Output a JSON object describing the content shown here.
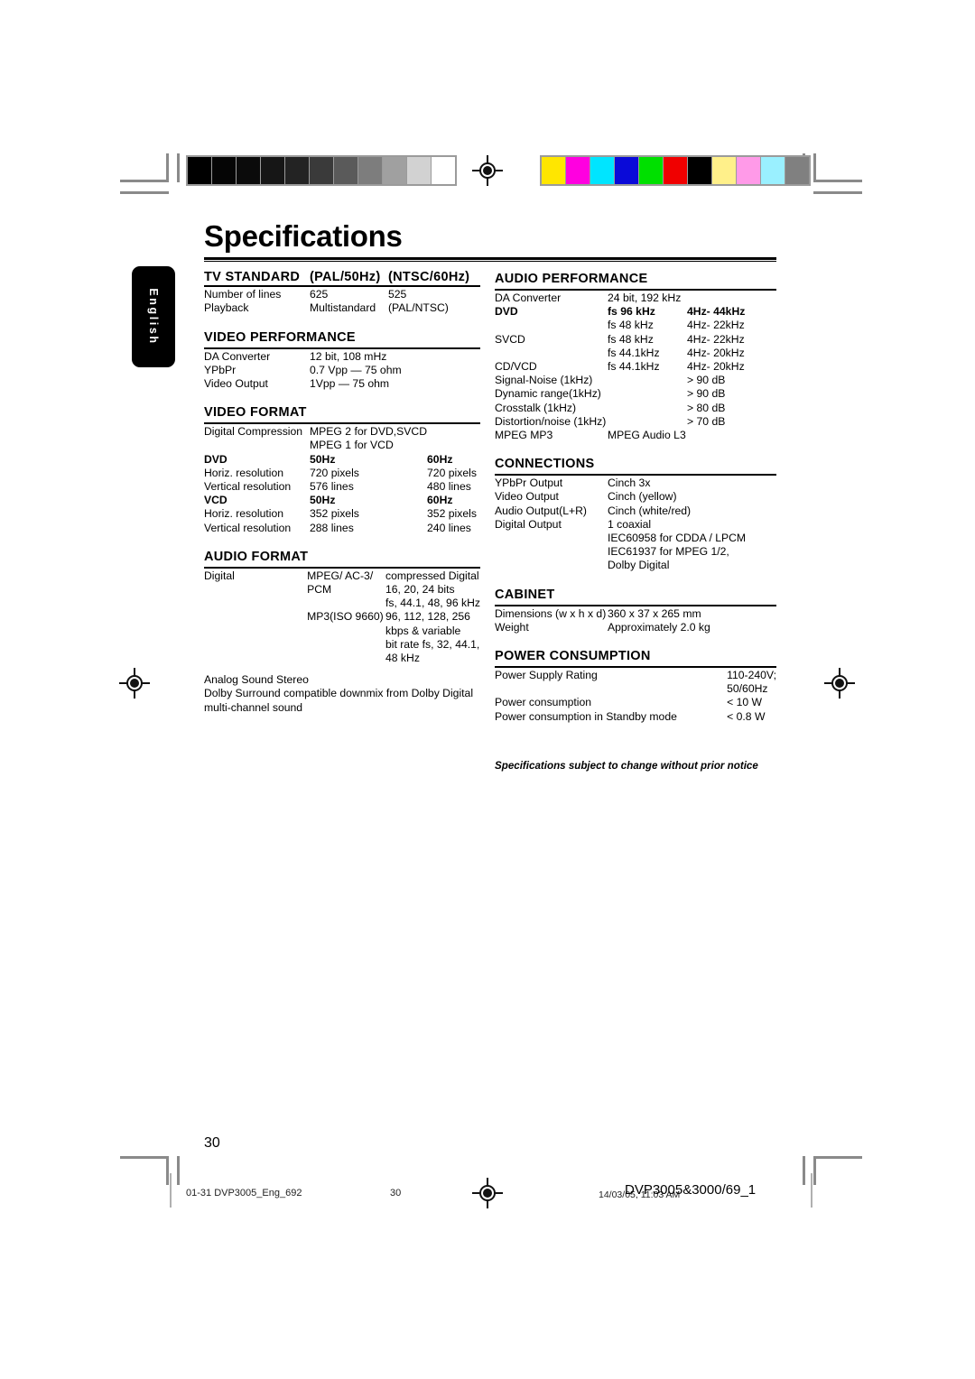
{
  "page": {
    "title": "Specifications",
    "language_tab": "English",
    "page_number": "30",
    "note": "Specifications subject to change without prior notice"
  },
  "print_footer": {
    "left": "01-31 DVP3005_Eng_692",
    "center": "30",
    "timestamp": "14/03/05, 11:03 AM",
    "doc_id": "DVP3005&3000/69_1"
  },
  "calibration": {
    "grayscale": [
      "#000000",
      "#050505",
      "#0b0b0b",
      "#161616",
      "#232323",
      "#3a3a3a",
      "#5a5a5a",
      "#7d7d7d",
      "#a0a0a0",
      "#d2d2d2",
      "#ffffff"
    ],
    "colors": [
      "#ffe600",
      "#ff00e0",
      "#00e5ff",
      "#0a0ad8",
      "#00e000",
      "#f00000",
      "#000000",
      "#fff08a",
      "#ff9ae8",
      "#9af0ff",
      "#808080"
    ]
  },
  "left_column": [
    {
      "id": "tv-standard",
      "heading": "TV STANDARD  (PAL/50Hz)  (NTSC/60Hz)",
      "header_cells": [
        "TV STANDARD",
        "(PAL/50Hz)",
        "(NTSC/60Hz)"
      ],
      "rows": [
        [
          "Number of lines",
          "625",
          "525"
        ],
        [
          "Playback",
          "Multistandard",
          "(PAL/NTSC)"
        ]
      ]
    },
    {
      "id": "video-performance",
      "heading": "VIDEO PERFORMANCE",
      "rows": [
        [
          "DA Converter",
          "12 bit, 108 mHz",
          ""
        ],
        [
          "YPbPr",
          "0.7 Vpp — 75 ohm",
          ""
        ],
        [
          "Video Output",
          "1Vpp — 75 ohm",
          ""
        ]
      ]
    },
    {
      "id": "video-format",
      "heading": "VIDEO FORMAT",
      "rows": [
        [
          "Digital Compression",
          "MPEG 2 for DVD,SVCD",
          ""
        ],
        [
          "",
          "MPEG 1 for VCD",
          ""
        ],
        [
          "DVD",
          "50Hz",
          "60Hz"
        ],
        [
          "Horiz. resolution",
          "720 pixels",
          "720 pixels"
        ],
        [
          "Vertical resolution",
          "576 lines",
          "480 lines"
        ],
        [
          "VCD",
          "50Hz",
          "60Hz"
        ],
        [
          "Horiz. resolution",
          "352 pixels",
          "352 pixels"
        ],
        [
          "Vertical resolution",
          "288 lines",
          "240 lines"
        ]
      ]
    },
    {
      "id": "audio-format",
      "heading": "AUDIO FORMAT",
      "rows": [
        [
          "Digital",
          "MPEG/ AC-3/",
          "compressed Digital"
        ],
        [
          "",
          "PCM",
          "16, 20, 24 bits"
        ],
        [
          "",
          "",
          "fs, 44.1, 48, 96 kHz"
        ],
        [
          "",
          "MP3(ISO 9660)",
          "96, 112, 128, 256"
        ],
        [
          "",
          "",
          "kbps & variable"
        ],
        [
          "",
          "",
          "bit rate fs, 32, 44.1,"
        ],
        [
          "",
          "",
          "48 kHz"
        ]
      ],
      "trailing_lines": [
        "Analog Sound Stereo",
        "Dolby Surround compatible downmix from Dolby Digital",
        "multi-channel sound"
      ]
    }
  ],
  "right_column": [
    {
      "id": "audio-performance",
      "heading": "AUDIO PERFORMANCE",
      "rows": [
        [
          "DA Converter",
          "24 bit, 192 kHz",
          ""
        ],
        [
          "DVD",
          "fs 96 kHz",
          "4Hz- 44kHz"
        ],
        [
          "",
          "fs 48 kHz",
          "4Hz- 22kHz"
        ],
        [
          "SVCD",
          "fs 48 kHz",
          "4Hz- 22kHz"
        ],
        [
          "",
          "fs 44.1kHz",
          "4Hz- 20kHz"
        ],
        [
          "CD/VCD",
          "fs 44.1kHz",
          "4Hz- 20kHz"
        ],
        [
          "Signal-Noise (1kHz)",
          "",
          "> 90 dB"
        ],
        [
          "Dynamic range(1kHz)",
          "",
          "> 90 dB"
        ],
        [
          "Crosstalk (1kHz)",
          "",
          "> 80 dB"
        ],
        [
          "Distortion/noise (1kHz)",
          "",
          "> 70 dB"
        ],
        [
          "MPEG MP3",
          "MPEG Audio L3",
          ""
        ]
      ]
    },
    {
      "id": "connections",
      "heading": "CONNECTIONS",
      "rows": [
        [
          "YPbPr Output",
          "Cinch 3x",
          ""
        ],
        [
          "Video Output",
          "Cinch (yellow)",
          ""
        ],
        [
          "Audio Output(L+R)",
          "Cinch (white/red)",
          ""
        ],
        [
          "Digital Output",
          "1 coaxial",
          ""
        ],
        [
          "",
          "IEC60958 for CDDA / LPCM",
          ""
        ],
        [
          "",
          "IEC61937 for MPEG 1/2,",
          ""
        ],
        [
          "",
          "Dolby Digital",
          ""
        ]
      ]
    },
    {
      "id": "cabinet",
      "heading": "CABINET",
      "rows": [
        [
          "Dimensions (w x h x d)",
          "360 x 37 x 265 mm",
          ""
        ],
        [
          "Weight",
          "Approximately 2.0 kg",
          ""
        ]
      ]
    },
    {
      "id": "power-consumption",
      "heading": "POWER CONSUMPTION",
      "rows": [
        [
          "Power Supply Rating",
          "",
          "110-240V;"
        ],
        [
          "",
          "",
          "50/60Hz"
        ],
        [
          "Power consumption",
          "",
          "< 10 W"
        ],
        [
          "Power consumption in Standby mode",
          "",
          "< 0.8 W"
        ]
      ]
    }
  ]
}
